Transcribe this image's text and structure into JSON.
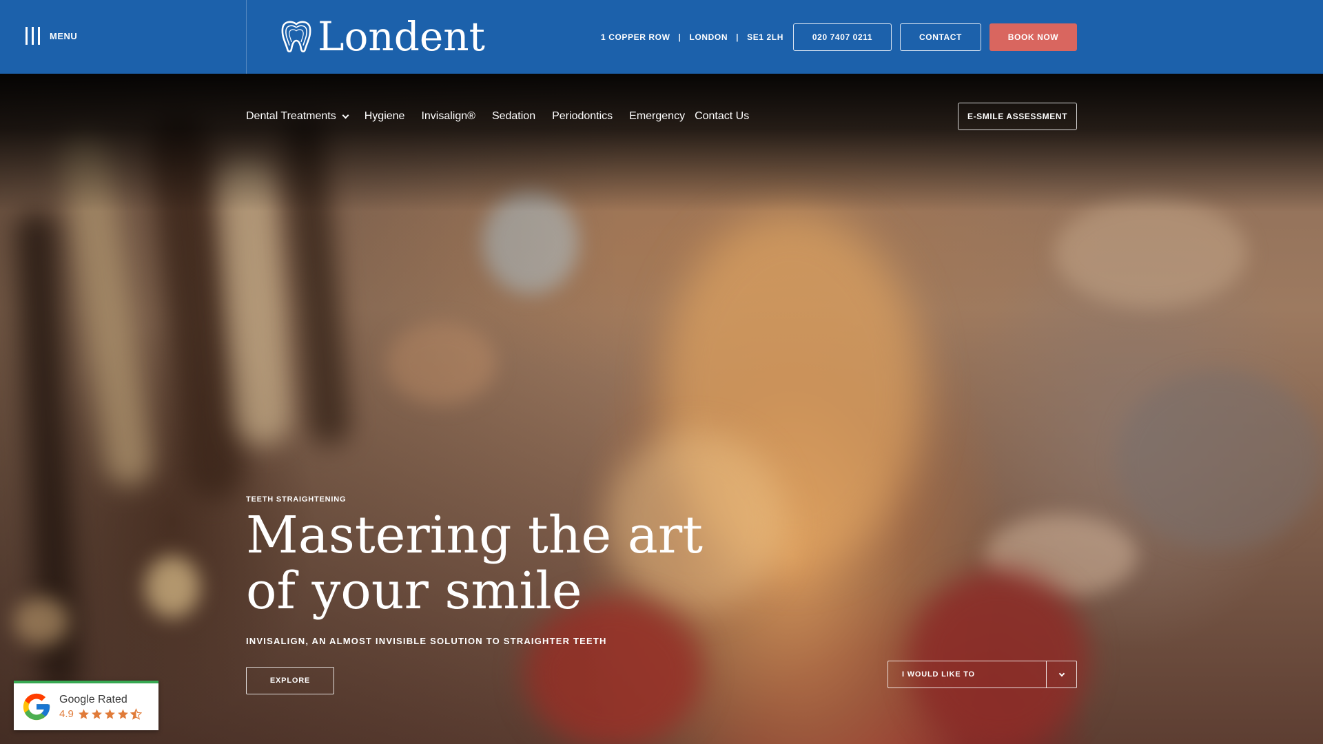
{
  "topbar": {
    "menu_label": "MENU",
    "logo_text": "Londent",
    "address": [
      "1 COPPER ROW",
      "LONDON",
      "SE1 2LH"
    ],
    "address_separator": "|",
    "phone_label": "020 7407 0211",
    "contact_label": "CONTACT",
    "book_label": "BOOK NOW",
    "brand_color": "#1c61ab",
    "book_color": "#d9665f"
  },
  "nav": {
    "items": [
      {
        "label": "Dental Treatments",
        "has_dropdown": true
      },
      {
        "label": "Hygiene"
      },
      {
        "label": "Invisalign®"
      },
      {
        "label": "Sedation"
      },
      {
        "label": "Periodontics"
      },
      {
        "label": "Emergency"
      },
      {
        "label": "Contact Us"
      }
    ],
    "esmile_label": "E-SMILE ASSESSMENT"
  },
  "hero": {
    "eyebrow": "TEETH STRAIGHTENING",
    "headline_line1": "Mastering the art",
    "headline_line2": "of your smile",
    "subline": "INVISALIGN, AN ALMOST INVISIBLE SOLUTION TO STRAIGHTER TEETH",
    "explore_label": "EXPLORE",
    "select_label": "I WOULD LIKE TO"
  },
  "google_badge": {
    "title": "Google Rated",
    "score": "4.9",
    "stars": 4.5,
    "star_color": "#e07b39"
  }
}
